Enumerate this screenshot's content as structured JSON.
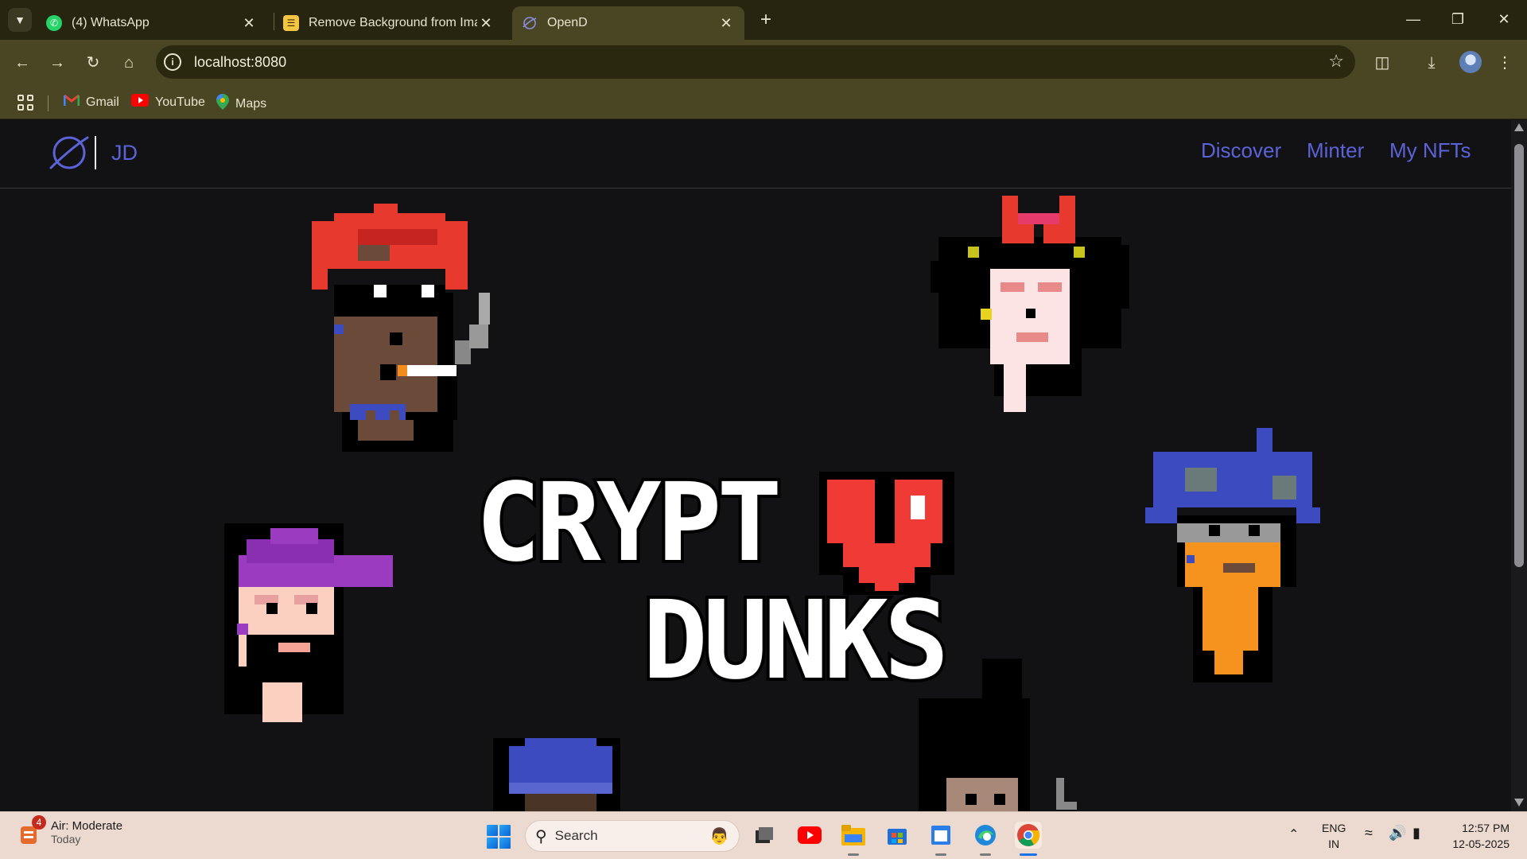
{
  "browser": {
    "tabs": [
      {
        "title": "(4) WhatsApp",
        "icon": "whatsapp-icon",
        "active": false
      },
      {
        "title": "Remove Background from Imag",
        "icon": "layers-icon",
        "active": false
      },
      {
        "title": "OpenD",
        "icon": "planet-icon",
        "active": true
      }
    ],
    "url": "localhost:8080",
    "bookmarks": [
      {
        "label": "Gmail",
        "icon": "gmail-icon"
      },
      {
        "label": "YouTube",
        "icon": "youtube-icon"
      },
      {
        "label": "Maps",
        "icon": "maps-icon"
      }
    ]
  },
  "site": {
    "brand": "JD",
    "nav": [
      "Discover",
      "Minter",
      "My NFTs"
    ],
    "accent": "#5b63d6",
    "hero": {
      "line1": "CRYPT",
      "line2": "DUNKS"
    }
  },
  "taskbar": {
    "weather": {
      "title": "Air: Moderate",
      "subtitle": "Today",
      "badge": "4"
    },
    "search_placeholder": "Search",
    "language": {
      "line1": "ENG",
      "line2": "IN"
    },
    "time": "12:57 PM",
    "date": "12-05-2025"
  }
}
